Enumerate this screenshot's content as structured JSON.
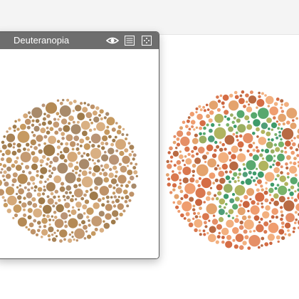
{
  "window": {
    "title": "Deuteranopia",
    "title_bar_color": "#6e6e6e"
  },
  "icons": {
    "eye": "eye-icon",
    "list": "list-icon",
    "dots": "dots-icon"
  },
  "colors": {
    "left_plate_palette": [
      "#c69a61",
      "#b48a55",
      "#d4a878",
      "#a88357",
      "#c49a72",
      "#b99476",
      "#9f7b4b",
      "#d9b083",
      "#be9268",
      "#a88a6a"
    ],
    "right_plate_background_palette": [
      "#e58f67",
      "#d9784f",
      "#ef9d6f",
      "#c9653f",
      "#f2b07f",
      "#d56d45",
      "#e4a36d",
      "#b86a43"
    ],
    "right_plate_figure_palette": [
      "#3e9b6a",
      "#58a86e",
      "#79b36a",
      "#9aae62",
      "#4f9e78",
      "#b0b45f"
    ]
  }
}
